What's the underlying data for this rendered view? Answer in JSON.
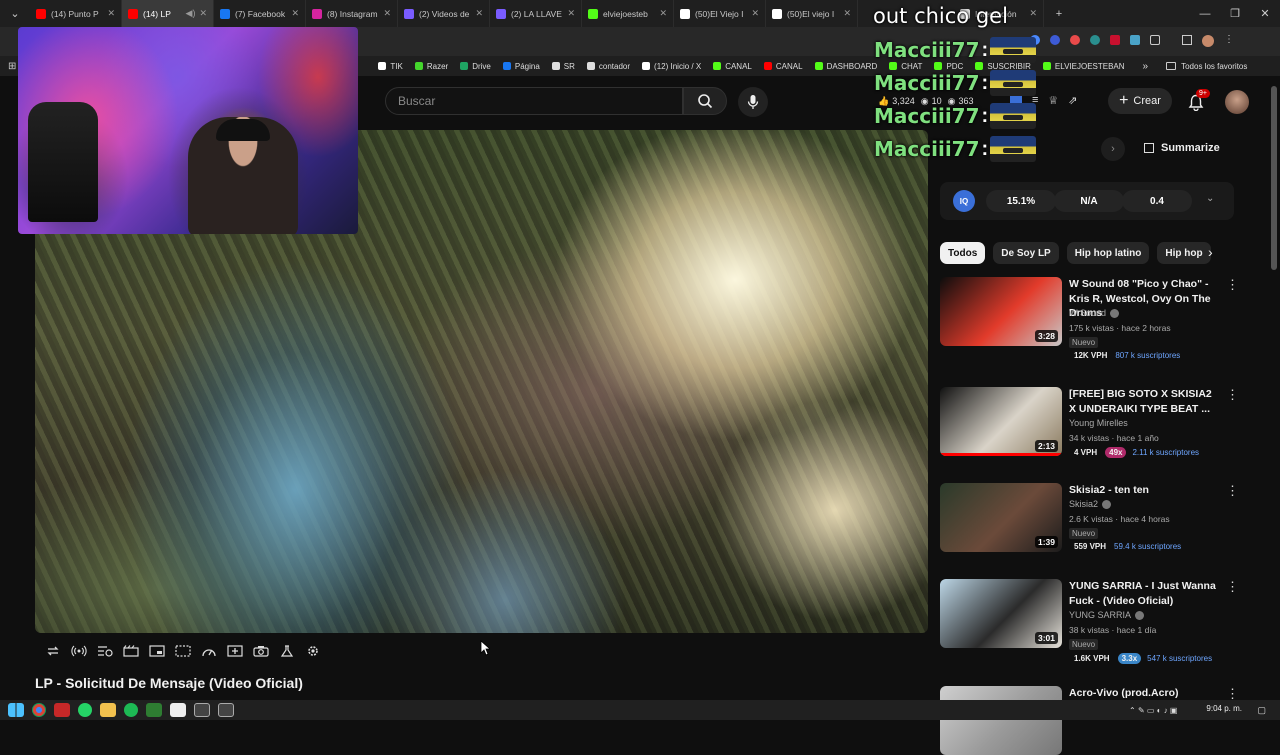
{
  "browser": {
    "tabs": [
      {
        "title": "(14) Punto P",
        "favicon_color": "#ff0000"
      },
      {
        "title": "(14) LP",
        "favicon_color": "#ff0000",
        "active": true
      },
      {
        "title": "(7) Facebook",
        "favicon_color": "#1877f2"
      },
      {
        "title": "(8) Instagram",
        "favicon_color": "#d6249f"
      },
      {
        "title": "(2) Videos de",
        "favicon_color": "#7a5cff"
      },
      {
        "title": "(2) LA LLAVE",
        "favicon_color": "#7a5cff"
      },
      {
        "title": "elviejoesteb",
        "favicon_color": "#53fc18"
      },
      {
        "title": "(50)El Viejo I",
        "favicon_color": "#ffffff"
      },
      {
        "title": "(50)El viejo I",
        "favicon_color": "#ffffff"
      }
    ],
    "last_tab": {
      "title": "Interacción",
      "favicon_color": "#dddddd"
    },
    "new_tab_label": "+",
    "bookmarks": [
      {
        "label": "TIK",
        "color": "#ffffff"
      },
      {
        "label": "Razer",
        "color": "#44d62c"
      },
      {
        "label": "Drive",
        "color": "#1fa463"
      },
      {
        "label": "Página",
        "color": "#1877f2"
      },
      {
        "label": "SR",
        "color": "#dddddd"
      },
      {
        "label": "contador",
        "color": "#dddddd"
      },
      {
        "label": "(12) Inicio / X",
        "color": "#ffffff"
      },
      {
        "label": "CANAL",
        "color": "#53fc18"
      },
      {
        "label": "CANAL",
        "color": "#ff0000"
      },
      {
        "label": "DASHBOARD",
        "color": "#53fc18"
      },
      {
        "label": "CHAT",
        "color": "#53fc18"
      },
      {
        "label": "PDC",
        "color": "#53fc18"
      },
      {
        "label": "SUSCRIBIR",
        "color": "#53fc18"
      },
      {
        "label": "ELVIEJOESTEBAN",
        "color": "#53fc18"
      }
    ],
    "bookmarks_more": "»",
    "all_bookmarks": "Todos los favoritos"
  },
  "header": {
    "search_placeholder": "Buscar",
    "create_label": "Crear",
    "notif_badge": "9+"
  },
  "stream_overlay": {
    "header_text": "out chico gel",
    "chat": [
      {
        "user": "Macciii77",
        "colon": ":"
      },
      {
        "user": "Macciii77",
        "colon": ":"
      },
      {
        "user": "Macciii77",
        "colon": ":"
      },
      {
        "user": "Macciii77",
        "colon": ":"
      }
    ]
  },
  "ext_stats": {
    "likes": "3,324",
    "views": "10",
    "viewers": "363"
  },
  "sidebar": {
    "summarize_label": "Summarize",
    "iq": {
      "logo": "IQ",
      "stats": [
        "15.1%",
        "N/A",
        "0.4"
      ]
    },
    "chips": [
      "Todos",
      "De Soy LP",
      "Hip hop latino",
      "Hip hop"
    ],
    "recommendations": [
      {
        "title": "W Sound 08 \"Pico y Chao\" - Kris R, Westcol, Ovy On The Drums",
        "channel": "W Sound",
        "verified": true,
        "meta": "175 k vistas · hace 2 horas",
        "badge": "Nuevo",
        "duration": "3:28",
        "vph": "12K VPH",
        "multiplier": "",
        "subs": "807 k suscriptores",
        "thumb_colors": [
          "#0d0d0d",
          "#e23b2b",
          "#c8c8c8"
        ]
      },
      {
        "title": "[FREE] BIG SOTO X SKISIA2 X UNDERAIKI TYPE BEAT ...",
        "channel": "Young Mirelles",
        "verified": false,
        "meta": "34 k vistas · hace 1 año",
        "badge": "",
        "duration": "2:13",
        "vph": "4 VPH",
        "multiplier": "49x",
        "multiplier_color": "#b02a6a",
        "subs": "2.11 k suscriptores",
        "thumb_colors": [
          "#111111",
          "#d9d3c8",
          "#8a7a5f"
        ]
      },
      {
        "title": "Skisia2 - ten ten",
        "channel": "Skisia2",
        "verified": true,
        "meta": "2.6 K vistas · hace 4 horas",
        "badge": "Nuevo",
        "duration": "1:39",
        "vph": "559 VPH",
        "multiplier": "",
        "subs": "59.4 k suscriptores",
        "thumb_colors": [
          "#2a3a2a",
          "#6b4a3a",
          "#1c1c1c"
        ]
      },
      {
        "title": "YUNG SARRIA - I Just Wanna Fuck - (Video Oficial)",
        "channel": "YUNG SARRIA",
        "verified": true,
        "meta": "38 k vistas · hace 1 día",
        "badge": "Nuevo",
        "duration": "3:01",
        "vph": "1.6K VPH",
        "multiplier": "3.3x",
        "multiplier_color": "#3a86c8",
        "subs": "547 k suscriptores",
        "thumb_colors": [
          "#bcd6e6",
          "#2b2b2b",
          "#e8e4dc"
        ]
      },
      {
        "title": "Acro-Vivo (prod.Acro)",
        "channel": "",
        "verified": false,
        "meta": "",
        "badge": "",
        "duration": "",
        "vph": "",
        "multiplier": "",
        "subs": "",
        "thumb_colors": [
          "#cfcfcf",
          "#9a9a9a",
          "#777777"
        ]
      }
    ]
  },
  "video": {
    "title": "LP - Solicitud De Mensaje (Video Oficial)"
  },
  "taskbar": {
    "clock": "9:04 p. m."
  }
}
